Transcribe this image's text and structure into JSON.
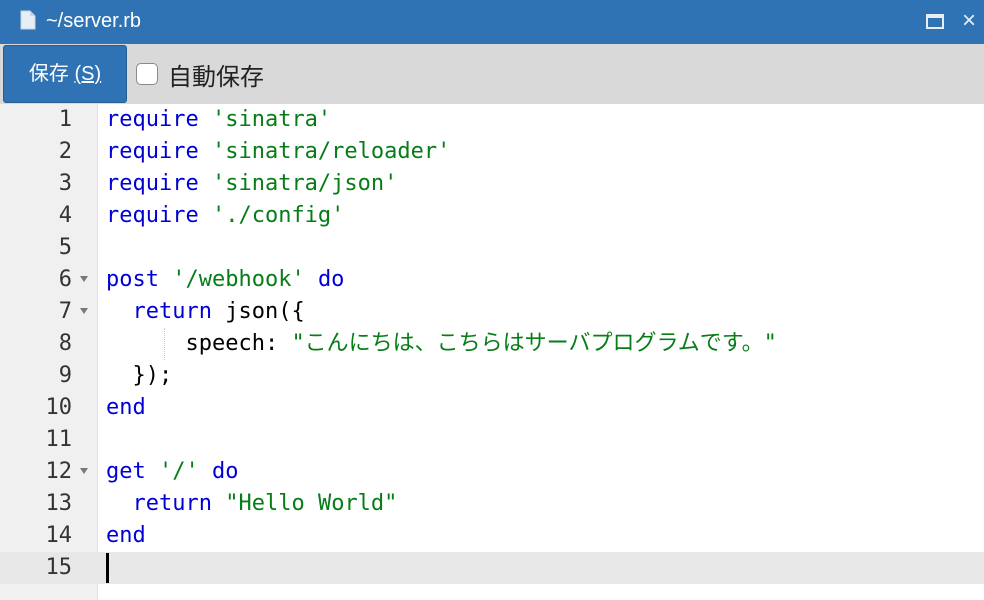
{
  "window": {
    "title": "~/server.rb",
    "icons": {
      "file": "file-icon",
      "maximize": "maximize-icon",
      "close": "close-icon"
    },
    "close_glyph": "×"
  },
  "toolbar": {
    "save_label": "保存 ",
    "save_accel": "(S)",
    "autosave_label": "自動保存",
    "autosave_checked": false
  },
  "editor": {
    "language": "ruby",
    "active_line": 15,
    "cursor": {
      "line": 15,
      "column": 1
    },
    "lines": [
      {
        "n": "1"
      },
      {
        "n": "2"
      },
      {
        "n": "3"
      },
      {
        "n": "4"
      },
      {
        "n": "5"
      },
      {
        "n": "6",
        "fold": true
      },
      {
        "n": "7",
        "fold": true
      },
      {
        "n": "8"
      },
      {
        "n": "9"
      },
      {
        "n": "10"
      },
      {
        "n": "11"
      },
      {
        "n": "12",
        "fold": true
      },
      {
        "n": "13"
      },
      {
        "n": "14"
      },
      {
        "n": "15"
      }
    ],
    "tokens": {
      "l1": [
        "require",
        " ",
        "'sinatra'"
      ],
      "l2": [
        "require",
        " ",
        "'sinatra/reloader'"
      ],
      "l3": [
        "require",
        " ",
        "'sinatra/json'"
      ],
      "l4": [
        "require",
        " ",
        "'./config'"
      ],
      "l6": [
        "post",
        " ",
        "'/webhook'",
        " ",
        "do"
      ],
      "l7": [
        "  ",
        "return",
        " json({"
      ],
      "l8": [
        "      speech: ",
        "\"こんにちは、こちらはサーバプログラムです。\""
      ],
      "l9": [
        "  });"
      ],
      "l10": [
        "end"
      ],
      "l12": [
        "get",
        " ",
        "'/'",
        " ",
        "do"
      ],
      "l13": [
        "  ",
        "return",
        " ",
        "\"Hello World\""
      ],
      "l14": [
        "end"
      ]
    }
  },
  "colors": {
    "titlebar": "#2f73b5",
    "keyword": "#0000d6",
    "string": "#067d17",
    "gutter": "#f0f0f0",
    "active_line": "#e8e8e8"
  }
}
